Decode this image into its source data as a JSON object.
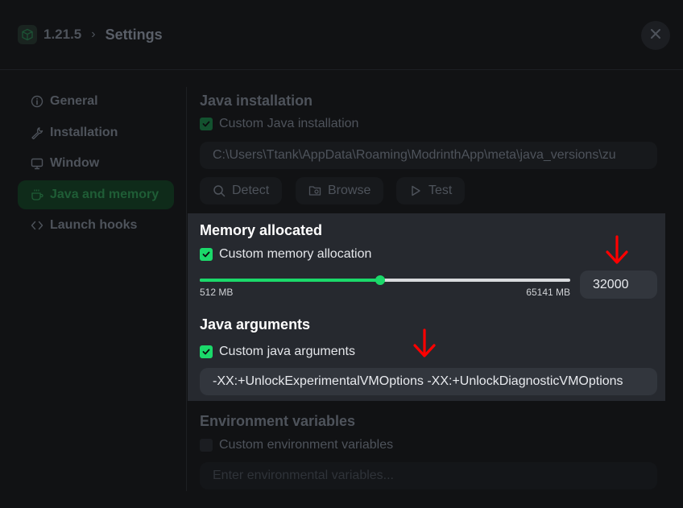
{
  "header": {
    "version": "1.21.5",
    "separator": "›",
    "title": "Settings",
    "close_icon": "close-icon",
    "cube_icon": "cube-icon"
  },
  "sidebar": {
    "items": [
      {
        "label": "General",
        "icon": "info-icon",
        "active": false
      },
      {
        "label": "Installation",
        "icon": "wrench-icon",
        "active": false
      },
      {
        "label": "Window",
        "icon": "monitor-icon",
        "active": false
      },
      {
        "label": "Java and memory",
        "icon": "coffee-icon",
        "active": true
      },
      {
        "label": "Launch hooks",
        "icon": "code-icon",
        "active": false
      }
    ]
  },
  "java_installation": {
    "title": "Java installation",
    "checkbox_label": "Custom Java installation",
    "checked": true,
    "path": "C:\\Users\\Ttank\\AppData\\Roaming\\ModrinthApp\\meta\\java_versions\\zu",
    "buttons": {
      "detect": "Detect",
      "browse": "Browse",
      "test": "Test"
    }
  },
  "memory": {
    "title": "Memory allocated",
    "checkbox_label": "Custom memory allocation",
    "checked": true,
    "min_label": "512 MB",
    "max_label": "65141 MB",
    "min": 512,
    "max": 65141,
    "value": 32000,
    "value_text": "32000"
  },
  "java_arguments": {
    "title": "Java arguments",
    "checkbox_label": "Custom java arguments",
    "checked": true,
    "value": "-XX:+UnlockExperimentalVMOptions -XX:+UnlockDiagnosticVMOptions"
  },
  "environment": {
    "title": "Environment variables",
    "checkbox_label": "Custom environment variables",
    "checked": false,
    "placeholder": "Enter environmental variables..."
  },
  "colors": {
    "accent": "#1bd96a",
    "highlight_panel": "#26292f",
    "annotation_arrow": "#ff0000"
  }
}
